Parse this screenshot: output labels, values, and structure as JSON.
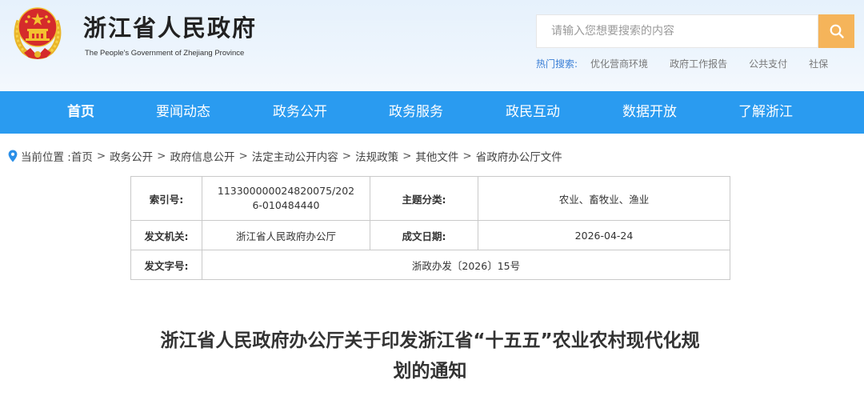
{
  "header": {
    "site_title": "浙江省人民政府",
    "site_subtitle": "The People's Government of Zhejiang Province",
    "colors": {
      "emblem_red": "#d52b2b",
      "emblem_gold": "#f3c230",
      "accent_orange": "#f5b45a",
      "nav_blue": "#2a9bf0"
    }
  },
  "search": {
    "placeholder": "请输入您想要搜索的内容",
    "button_icon": "search-icon",
    "hot_label": "热门搜索:",
    "hot_links": [
      "优化营商环境",
      "政府工作报告",
      "公共支付",
      "社保"
    ]
  },
  "nav": {
    "items": [
      "首页",
      "要闻动态",
      "政务公开",
      "政务服务",
      "政民互动",
      "数据开放",
      "了解浙江"
    ],
    "active": "首页"
  },
  "breadcrumb": {
    "prefix": "当前位置 :",
    "items": [
      "首页",
      "政务公开",
      "政府信息公开",
      "法定主动公开内容",
      "法规政策",
      "其他文件",
      "省政府办公厅文件"
    ],
    "separator": ">"
  },
  "meta": {
    "index_label": "索引号:",
    "index_value": "113300000024820075/2026-010484440",
    "topic_label": "主题分类:",
    "topic_value": "农业、畜牧业、渔业",
    "issuer_label": "发文机关:",
    "issuer_value": "浙江省人民政府办公厅",
    "date_label": "成文日期:",
    "date_value": "2026-04-24",
    "doc_no_label": "发文字号:",
    "doc_no_value": "浙政办发〔2026〕15号"
  },
  "article": {
    "title_line1": "浙江省人民政府办公厅关于印发浙江省“十五五”农业农村现代化规",
    "title_line2": "划的通知"
  }
}
